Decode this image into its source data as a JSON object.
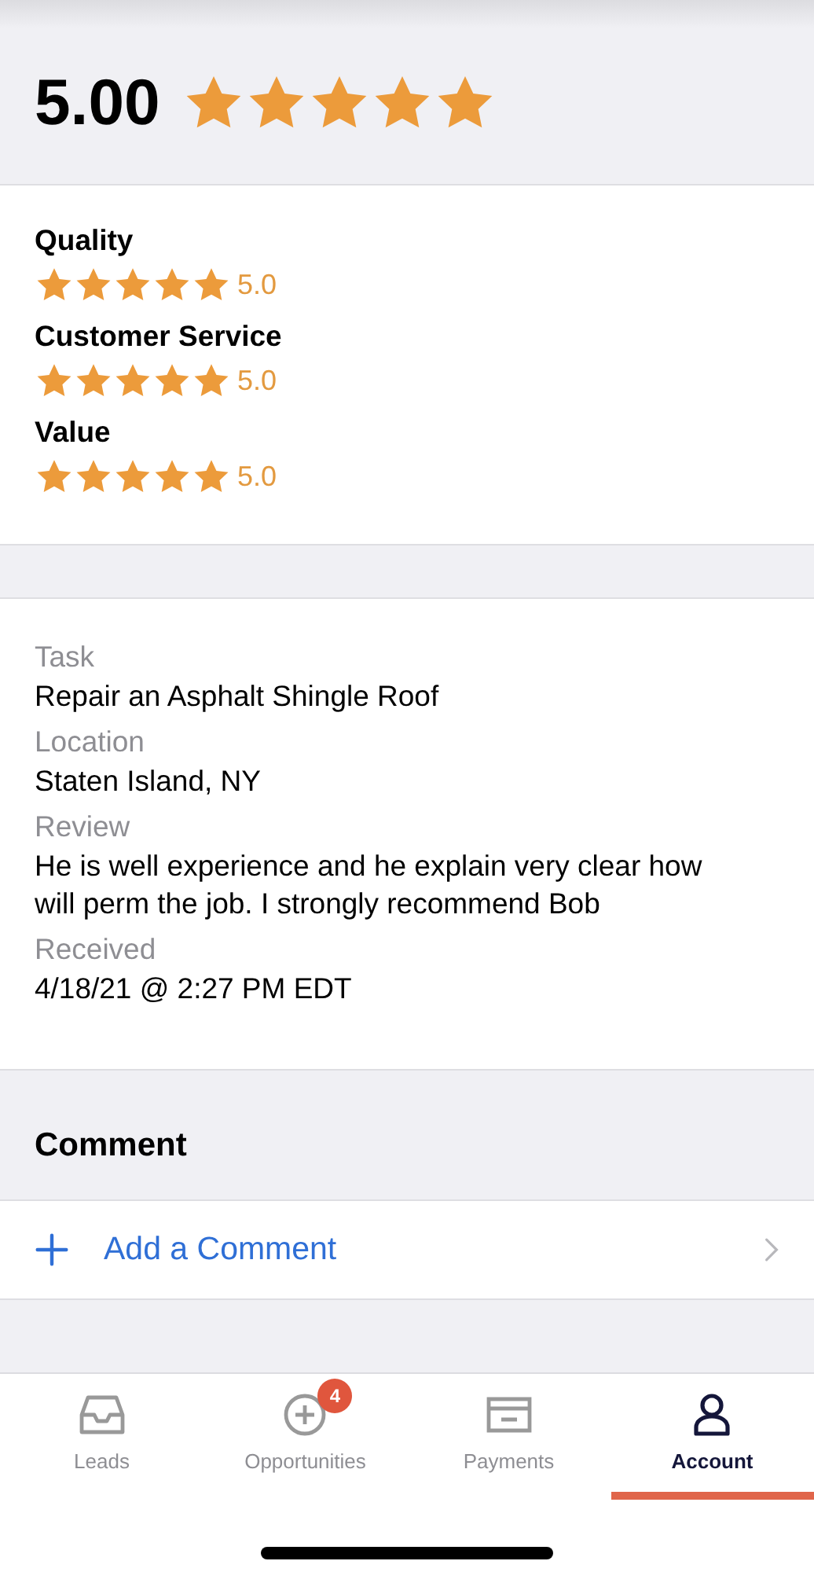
{
  "overall": {
    "score": "5.00",
    "stars": 5
  },
  "categories": [
    {
      "label": "Quality",
      "stars": 5,
      "score": "5.0"
    },
    {
      "label": "Customer Service",
      "stars": 5,
      "score": "5.0"
    },
    {
      "label": "Value",
      "stars": 5,
      "score": "5.0"
    }
  ],
  "details": [
    {
      "label": "Task",
      "value": "Repair an Asphalt Shingle Roof"
    },
    {
      "label": "Location",
      "value": "Staten Island, NY"
    },
    {
      "label": "Review",
      "value": "He is well experience and he explain very clear how will perm the job. I strongly recommend Bob"
    },
    {
      "label": "Received",
      "value": "4/18/21 @ 2:27 PM EDT"
    }
  ],
  "comment": {
    "title": "Comment",
    "action": "Add a Comment"
  },
  "tabs": [
    {
      "label": "Leads",
      "selected": false
    },
    {
      "label": "Opportunities",
      "selected": false,
      "badge": "4"
    },
    {
      "label": "Payments",
      "selected": false
    },
    {
      "label": "Account",
      "selected": true
    }
  ]
}
